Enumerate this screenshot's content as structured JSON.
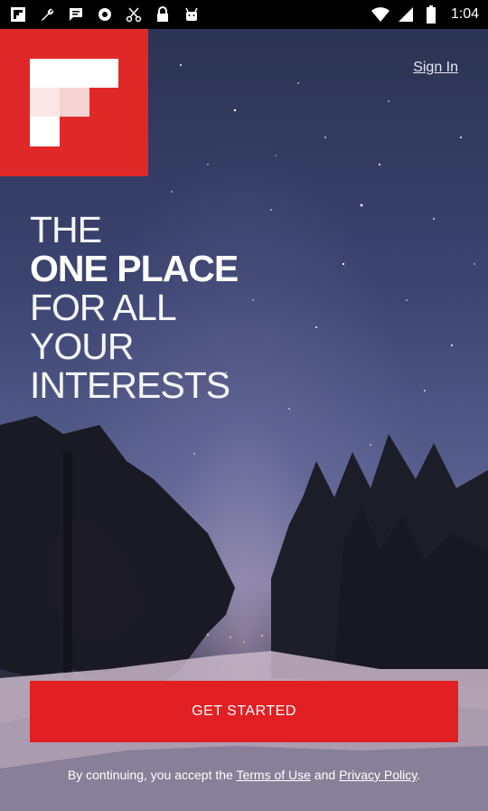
{
  "status_bar": {
    "time": "1:04",
    "left_icons": [
      "flipboard-icon",
      "wrench-icon",
      "message-icon",
      "settings-icon",
      "scissors-icon",
      "lock-icon",
      "android-icon"
    ],
    "right_icons": [
      "wifi-icon",
      "signal-icon",
      "battery-icon"
    ]
  },
  "header": {
    "signin_label": "Sign In"
  },
  "headline": {
    "line1": "THE",
    "line2": "ONE PLACE",
    "line3": "FOR ALL",
    "line4": "YOUR",
    "line5": "INTERESTS"
  },
  "cta": {
    "label": "GET STARTED"
  },
  "legal": {
    "prefix": "By continuing, you accept the",
    "terms": "Terms of Use",
    "and": "and",
    "privacy": "Privacy Policy",
    "suffix": "."
  },
  "colors": {
    "brand_red": "#e12828",
    "cta_red": "#e21f23"
  }
}
